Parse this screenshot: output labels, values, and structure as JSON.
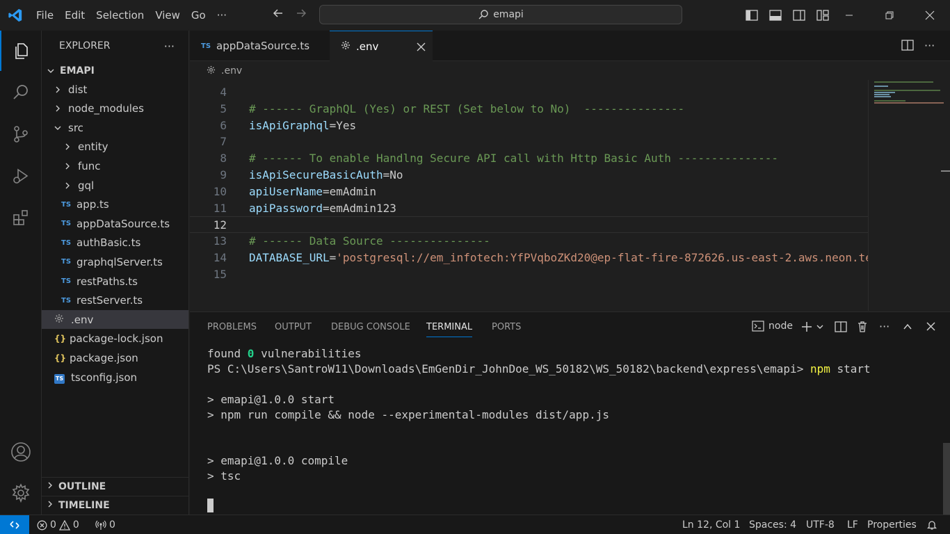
{
  "titlebar": {
    "menu": [
      "File",
      "Edit",
      "Selection",
      "View",
      "Go"
    ],
    "more": "···",
    "search_text": "emapi"
  },
  "sidebar": {
    "title": "EXPLORER",
    "more": "···",
    "root": "EMAPI",
    "items": [
      {
        "label": "dist",
        "kind": "folder",
        "expanded": false
      },
      {
        "label": "node_modules",
        "kind": "folder",
        "expanded": false
      },
      {
        "label": "src",
        "kind": "folder",
        "expanded": true
      },
      {
        "label": "entity",
        "kind": "folder",
        "expanded": false
      },
      {
        "label": "func",
        "kind": "folder",
        "expanded": false
      },
      {
        "label": "gql",
        "kind": "folder",
        "expanded": false
      },
      {
        "label": "app.ts",
        "kind": "ts"
      },
      {
        "label": "appDataSource.ts",
        "kind": "ts"
      },
      {
        "label": "authBasic.ts",
        "kind": "ts"
      },
      {
        "label": "graphqlServer.ts",
        "kind": "ts"
      },
      {
        "label": "restPaths.ts",
        "kind": "ts"
      },
      {
        "label": "restServer.ts",
        "kind": "ts"
      },
      {
        "label": ".env",
        "kind": "env",
        "selected": true
      },
      {
        "label": "package-lock.json",
        "kind": "json"
      },
      {
        "label": "package.json",
        "kind": "json"
      },
      {
        "label": "tsconfig.json",
        "kind": "tsconfig"
      }
    ],
    "outline": "OUTLINE",
    "timeline": "TIMELINE",
    "ts_badge": "TS",
    "json_badge": "{}"
  },
  "tabs": [
    {
      "label": "appDataSource.ts",
      "badge": "TS",
      "active": false
    },
    {
      "label": ".env",
      "badge": "",
      "active": true
    }
  ],
  "breadcrumb": ".env",
  "editor": {
    "current_line": "12",
    "lines": [
      {
        "n": "4",
        "segments": []
      },
      {
        "n": "5",
        "segments": [
          {
            "t": "# ------ GraphQL (Yes) or REST (Set below to No)  ---------------",
            "c": "cmt"
          }
        ]
      },
      {
        "n": "6",
        "segments": [
          {
            "t": "isApiGraphql",
            "c": "key"
          },
          {
            "t": "=Yes",
            "c": "plain"
          }
        ]
      },
      {
        "n": "7",
        "segments": []
      },
      {
        "n": "8",
        "segments": [
          {
            "t": "# ------ To enable Handlng Secure API call with Http Basic Auth ---------------",
            "c": "cmt"
          }
        ]
      },
      {
        "n": "9",
        "segments": [
          {
            "t": "isApiSecureBasicAuth",
            "c": "key"
          },
          {
            "t": "=No",
            "c": "plain"
          }
        ]
      },
      {
        "n": "10",
        "segments": [
          {
            "t": "apiUserName",
            "c": "key"
          },
          {
            "t": "=emAdmin",
            "c": "plain"
          }
        ]
      },
      {
        "n": "11",
        "segments": [
          {
            "t": "apiPassword",
            "c": "key"
          },
          {
            "t": "=emAdmin123",
            "c": "plain"
          }
        ]
      },
      {
        "n": "12",
        "segments": []
      },
      {
        "n": "13",
        "segments": [
          {
            "t": "# ------ Data Source ---------------",
            "c": "cmt"
          }
        ]
      },
      {
        "n": "14",
        "segments": [
          {
            "t": "DATABASE_URL",
            "c": "key"
          },
          {
            "t": "=",
            "c": "plain"
          },
          {
            "t": "'postgresql://em_infotech:YfPVqboZKd20@ep-flat-fire-872626.us-east-2.aws.neon.te",
            "c": "str"
          }
        ]
      },
      {
        "n": "15",
        "segments": []
      }
    ]
  },
  "panel": {
    "tabs": [
      "PROBLEMS",
      "OUTPUT",
      "DEBUG CONSOLE",
      "TERMINAL",
      "PORTS"
    ],
    "active_tab": "TERMINAL",
    "terminal_name": "node",
    "more": "···",
    "terminal": {
      "l1_pre": "found ",
      "l1_num": "0",
      "l1_post": " vulnerabilities",
      "l2_prompt": "PS C:\\Users\\SantroW11\\Downloads\\EmGenDir_JohnDoe_WS_50182\\WS_50182\\backend\\express\\emapi> ",
      "l2_cmd": "npm",
      "l2_arg": " start",
      "l3": "> emapi@1.0.0 start",
      "l4": "> npm run compile && node --experimental-modules dist/app.js",
      "l5": "> emapi@1.0.0 compile",
      "l6": "> tsc"
    }
  },
  "statusbar": {
    "errors": "0",
    "warnings": "0",
    "ports": "0",
    "position": "Ln 12, Col 1",
    "spaces": "Spaces: 4",
    "encoding": "UTF-8",
    "eol": "LF",
    "language": "Properties"
  },
  "colors": {
    "accent": "#0078d4",
    "comment": "#6a9955",
    "key": "#9cdcfe",
    "string": "#ce9178"
  }
}
